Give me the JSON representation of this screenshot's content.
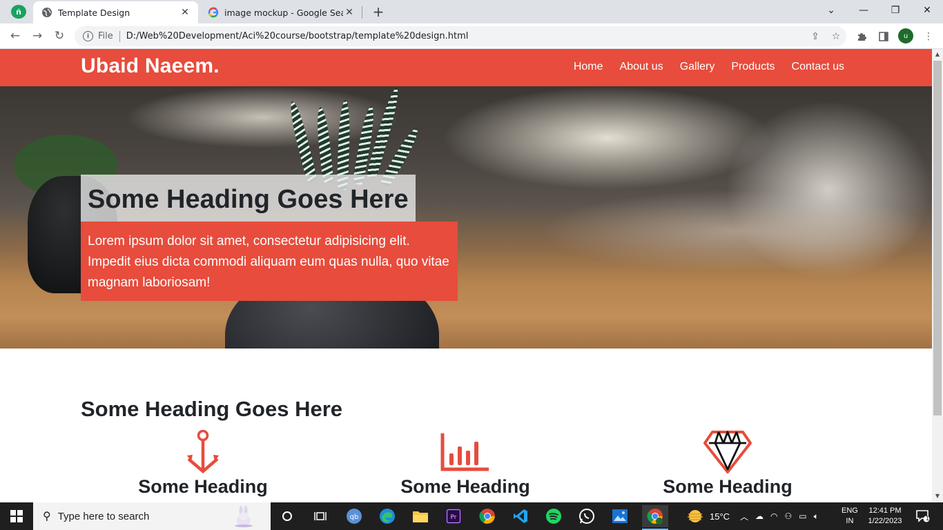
{
  "browser": {
    "tabs": [
      {
        "title": "Template Design",
        "active": true
      },
      {
        "title": "image mockup - Google Search",
        "active": false
      }
    ],
    "address": {
      "scheme_label": "File",
      "url": "D:/Web%20Development/Aci%20course/bootstrap/template%20design.html"
    },
    "profile_initial": "u"
  },
  "site": {
    "brand": "Ubaid Naeem.",
    "nav": [
      "Home",
      "About us",
      "Gallery",
      "Products",
      "Contact us"
    ],
    "hero": {
      "title": "Some Heading Goes Here",
      "text": "Lorem ipsum dolor sit amet, consectetur adipisicing elit. Impedit eius dicta commodi aliquam eum quas nulla, quo vitae magnam laboriosam!"
    },
    "section_title": "Some Heading Goes Here",
    "features": [
      {
        "icon": "anchor-icon",
        "heading": "Some Heading"
      },
      {
        "icon": "bar-chart-icon",
        "heading": "Some Heading"
      },
      {
        "icon": "diamond-icon",
        "heading": "Some Heading"
      }
    ],
    "accent_color": "#e74c3c"
  },
  "taskbar": {
    "search_placeholder": "Type here to search",
    "weather": "15°C",
    "language": "ENG",
    "region": "IN",
    "time": "12:41 PM",
    "date": "1/22/2023",
    "notification_count": "1"
  }
}
